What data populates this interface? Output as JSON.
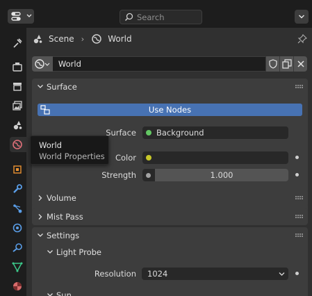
{
  "header": {
    "editor_type_icon": "properties-editor-icon",
    "search_placeholder": "Search"
  },
  "tabs": [
    {
      "name": "tool",
      "icon": "tool-icon"
    },
    {
      "name": "render",
      "icon": "render-icon"
    },
    {
      "name": "output",
      "icon": "output-icon"
    },
    {
      "name": "view-layer",
      "icon": "view-layer-icon"
    },
    {
      "name": "scene",
      "icon": "scene-icon"
    },
    {
      "name": "world",
      "icon": "world-icon",
      "active": true
    },
    {
      "name": "object",
      "icon": "object-icon"
    },
    {
      "name": "modifiers",
      "icon": "wrench-icon"
    },
    {
      "name": "particles",
      "icon": "particles-icon"
    },
    {
      "name": "physics",
      "icon": "physics-icon"
    },
    {
      "name": "constraints",
      "icon": "constraints-icon"
    },
    {
      "name": "data",
      "icon": "mesh-data-icon"
    },
    {
      "name": "material",
      "icon": "material-icon"
    }
  ],
  "breadcrumb": {
    "scene": "Scene",
    "world": "World"
  },
  "datablock": {
    "name": "World"
  },
  "tooltip": {
    "title": "World",
    "description": "World Properties"
  },
  "surface": {
    "title": "Surface",
    "use_nodes_label": "Use Nodes",
    "surface_label": "Surface",
    "surface_value": "Background",
    "color_label": "Color",
    "strength_label": "Strength",
    "strength_value": "1.000"
  },
  "collapsed_sections": {
    "volume": "Volume",
    "mist_pass": "Mist Pass"
  },
  "settings": {
    "title": "Settings",
    "light_probe_title": "Light Probe",
    "resolution_label": "Resolution",
    "resolution_value": "1024",
    "sun_title": "Sun"
  },
  "colors": {
    "accent_blue": "#4772b3",
    "socket_green": "#63c763",
    "socket_yellow": "#c7c729",
    "socket_grey": "#a1a1a1"
  }
}
